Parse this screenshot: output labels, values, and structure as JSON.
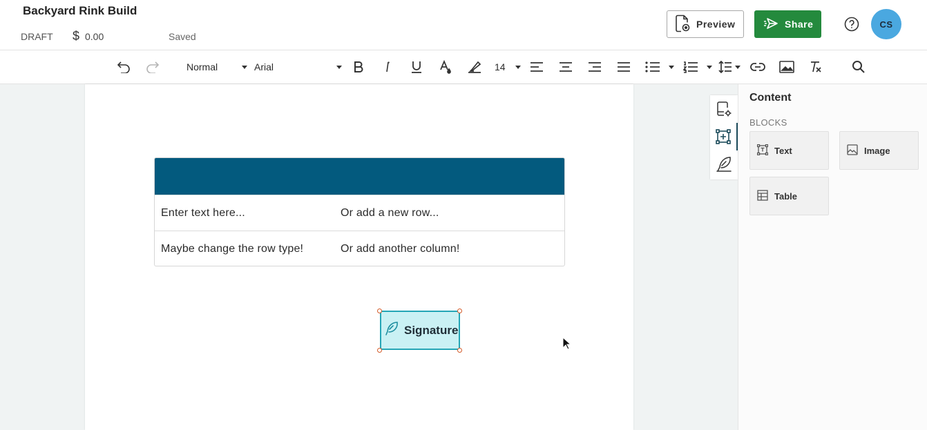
{
  "header": {
    "title": "Backyard Rink Build",
    "status": "DRAFT",
    "currency_symbol": "$",
    "amount": "0.00",
    "save_state": "Saved",
    "preview_label": "Preview",
    "share_label": "Share",
    "avatar_initials": "CS",
    "accent_share": "#248a3d",
    "avatar_color": "#4aa8e0"
  },
  "toolbar": {
    "style_select": "Normal",
    "font_select": "Arial",
    "font_size": "14",
    "icons": [
      "undo-icon",
      "redo-icon",
      "bold-icon",
      "italic-icon",
      "underline-icon",
      "text-color-icon",
      "highlight-icon",
      "align-left-icon",
      "align-center-icon",
      "align-right-icon",
      "align-justify-icon",
      "bullet-list-icon",
      "numbered-list-icon",
      "line-spacing-icon",
      "link-icon",
      "image-icon",
      "clear-format-icon",
      "search-icon"
    ]
  },
  "document": {
    "table": {
      "header_color": "#035a7e",
      "rows": [
        [
          "Enter text here...",
          "Or add a new row..."
        ],
        [
          "Maybe change the row type!",
          "Or add another column!"
        ]
      ]
    },
    "signature_label": "Signature"
  },
  "panel": {
    "title": "Content",
    "section": "BLOCKS",
    "blocks": [
      {
        "label": "Text",
        "icon": "text-block-icon"
      },
      {
        "label": "Image",
        "icon": "image-block-icon"
      },
      {
        "label": "Table",
        "icon": "table-block-icon"
      }
    ]
  }
}
